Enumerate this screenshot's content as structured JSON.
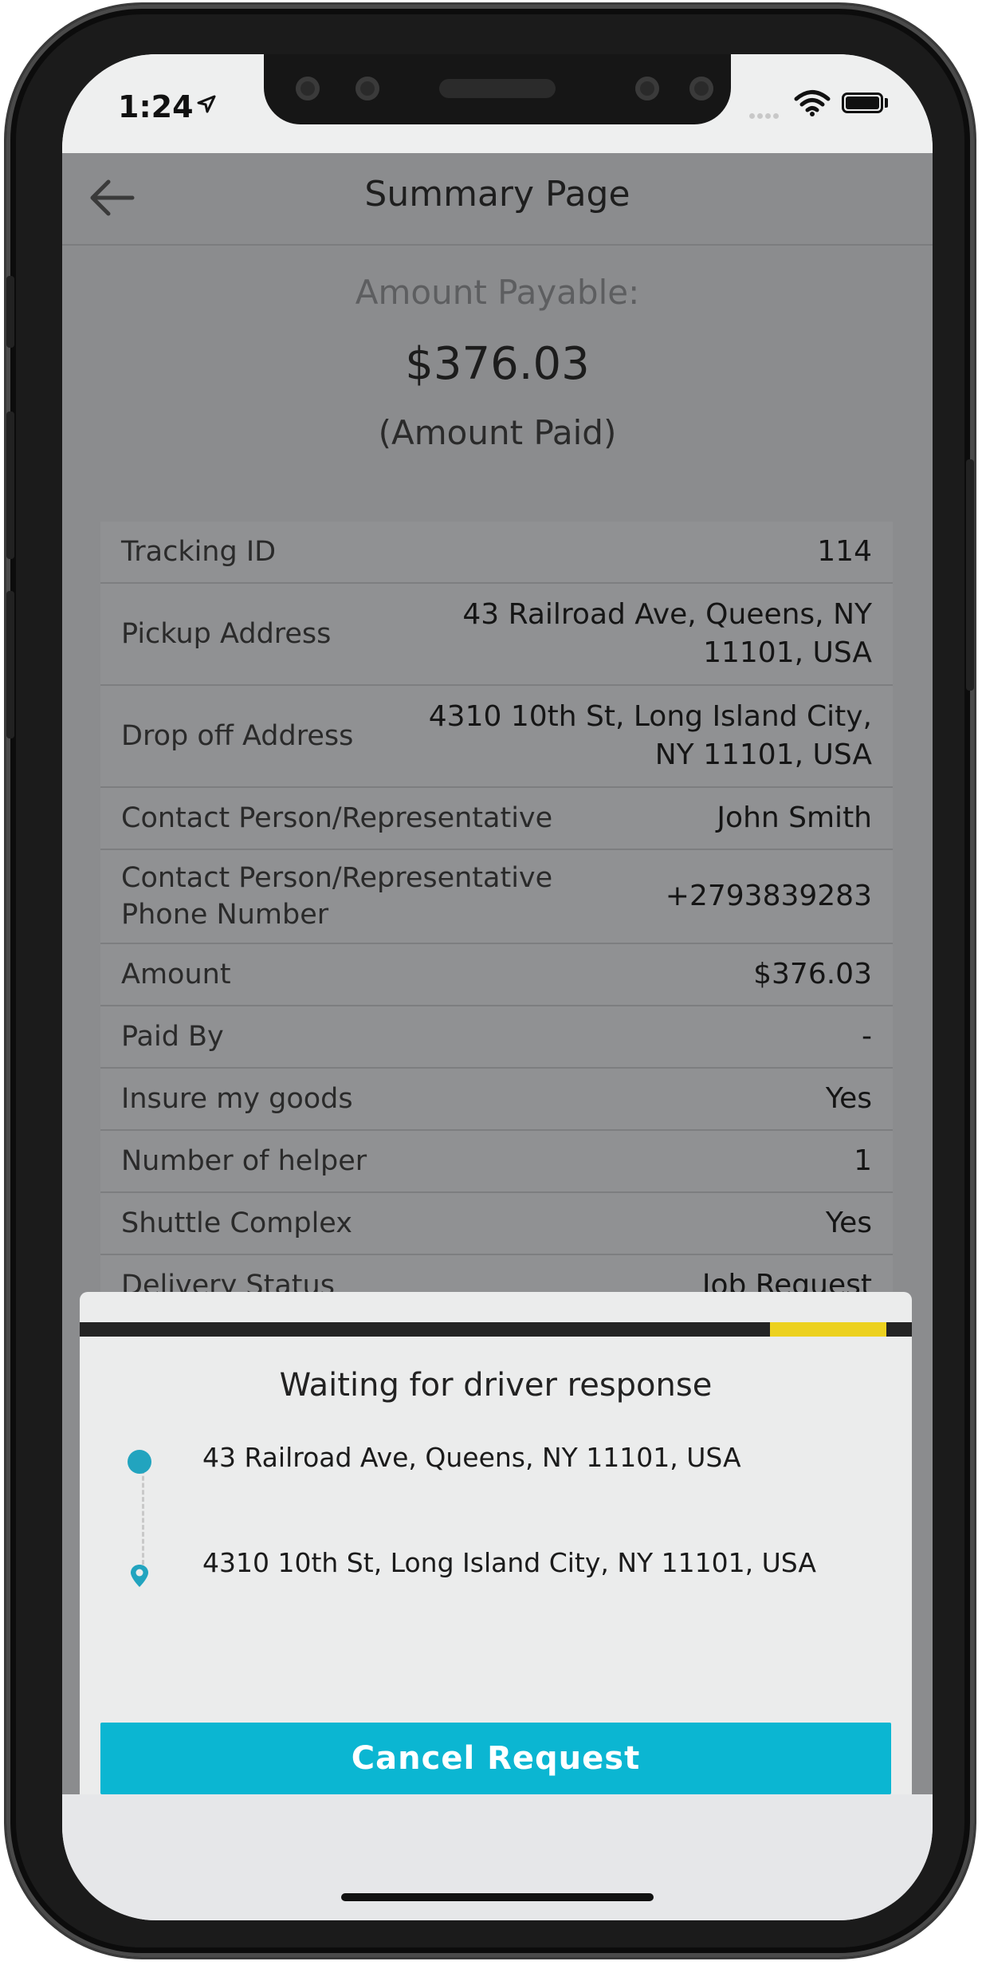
{
  "status_bar": {
    "time": "1:24"
  },
  "header": {
    "title": "Summary Page"
  },
  "amount": {
    "label": "Amount Payable:",
    "value": "$376.03",
    "note": "(Amount Paid)"
  },
  "details": [
    {
      "label": "Tracking ID",
      "value": "114"
    },
    {
      "label": "Pickup Address",
      "value_line1": "43 Railroad Ave, Queens, NY",
      "value_line2": "11101, USA"
    },
    {
      "label": "Drop off Address",
      "value_line1": "4310 10th St, Long Island City,",
      "value_line2": "NY 11101, USA"
    },
    {
      "label": "Contact Person/Representative",
      "value": "John Smith"
    },
    {
      "label_line1": "Contact Person/Representative",
      "label_line2": "Phone Number",
      "value": "+2793839283"
    },
    {
      "label": "Amount",
      "value": "$376.03"
    },
    {
      "label": "Paid By",
      "value": "-"
    },
    {
      "label": "Insure my goods",
      "value": "Yes"
    },
    {
      "label": "Number of helper",
      "value": "1"
    },
    {
      "label": "Shuttle Complex",
      "value": "Yes"
    },
    {
      "label": "Delivery Status",
      "value": "Job Request"
    }
  ],
  "sheet": {
    "title": "Waiting for driver response",
    "pickup": "43 Railroad Ave, Queens, NY 11101, USA",
    "dropoff": "4310 10th St, Long Island City, NY 11101, USA",
    "cancel_label": "Cancel Request",
    "progress": 0.14
  },
  "colors": {
    "accent": "#0bb6d2",
    "progress_fill": "#ecd11f",
    "route_dot": "#22a4bf"
  },
  "icons": [
    "back-arrow-icon",
    "location-arrow-icon",
    "wifi-icon",
    "battery-icon",
    "pickup-dot-icon",
    "dropoff-pin-icon"
  ]
}
